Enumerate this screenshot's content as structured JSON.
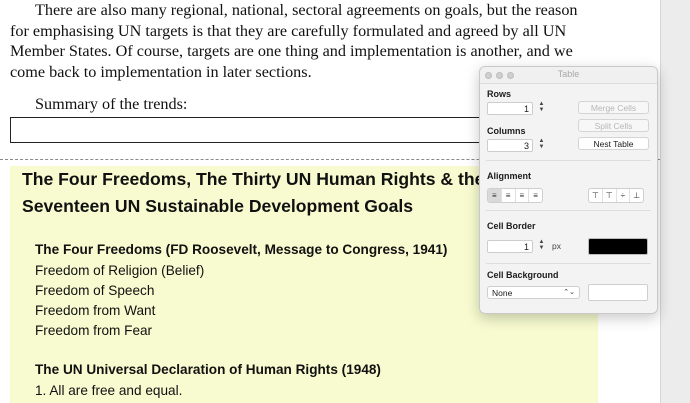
{
  "document": {
    "paragraph_lines": [
      "There are also many regional, national, sectoral agreements on goals, but the reason",
      "for emphasising UN targets is that they are carefully formulated and agreed by all UN",
      "Member States. Of course, targets are one thing and implementation is another, and we",
      "come back to implementation in later sections."
    ],
    "summary": "Summary of the trends:",
    "heading_lines": [
      "The Four Freedoms, The Thirty UN Human Rights & the",
      "Seventeen UN Sustainable Development Goals"
    ],
    "four_freedoms_title": "The Four Freedoms (FD Roosevelt, Message to Congress, 1941)",
    "freedoms": [
      "Freedom of Religion (Belief)",
      "Freedom of Speech",
      "Freedom from Want",
      "Freedom from Fear"
    ],
    "udhr_title": "The UN Universal Declaration of Human Rights (1948)",
    "rights": [
      "1. All are free and equal."
    ]
  },
  "panel": {
    "title": "Table",
    "rows_label": "Rows",
    "rows_value": "1",
    "columns_label": "Columns",
    "columns_value": "3",
    "merge_cells": "Merge Cells",
    "split_cells": "Split Cells",
    "nest_table": "Nest Table",
    "alignment_label": "Alignment",
    "cell_border_label": "Cell Border",
    "border_value": "1",
    "border_unit": "px",
    "border_color": "#000000",
    "cell_background_label": "Cell Background",
    "background_option": "None"
  },
  "colors": {
    "highlight": "#f7fbcf",
    "page": "#ffffff"
  }
}
